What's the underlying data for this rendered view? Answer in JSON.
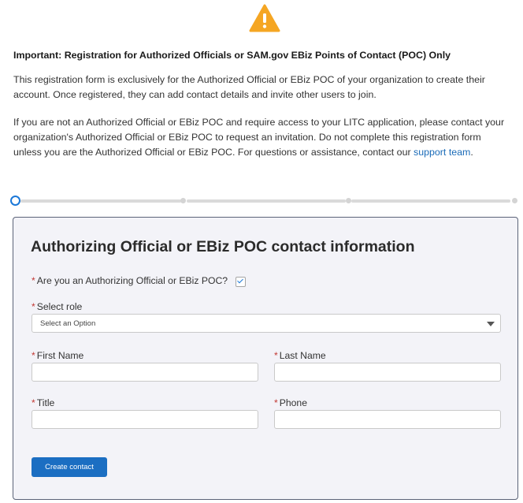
{
  "notice": {
    "heading": "Important: Registration for Authorized Officials or SAM.gov EBiz Points of Contact (POC) Only",
    "paragraph1": "This registration form is exclusively for the Authorized Official or EBiz POC of your organization to create their account. Once registered, they can add contact details and invite other users to join.",
    "paragraph2": "If you are not an Authorized Official or EBiz POC and require access to your LITC application, please contact your organization's Authorized Official or EBiz POC to request an invitation. Do not complete this registration form unless you are the Authorized Official or EBiz POC. For questions or assistance, contact our",
    "support_link": "support team",
    "paragraph2_end": "."
  },
  "icons": {
    "warning": "warning-triangle-icon"
  },
  "progress": {
    "current_step": 1,
    "total_steps": 4
  },
  "form": {
    "title": "Authorizing Official or EBiz POC contact information",
    "required_marker": "*",
    "is_ao_label": "Are you an Authorizing Official or EBiz POC?",
    "is_ao_checked": true,
    "role_label": "Select role",
    "role_value": "Select an Option",
    "first_name_label": "First Name",
    "first_name_value": "",
    "last_name_label": "Last Name",
    "last_name_value": "",
    "title_label": "Title",
    "title_value": "",
    "phone_label": "Phone",
    "phone_value": "",
    "submit_label": "Create contact"
  },
  "colors": {
    "warning": "#f5a623",
    "accent": "#1b78d8",
    "button": "#1b6ec2",
    "required": "#c23934",
    "card_border": "#5b6378",
    "card_bg": "#f3f3f8"
  }
}
